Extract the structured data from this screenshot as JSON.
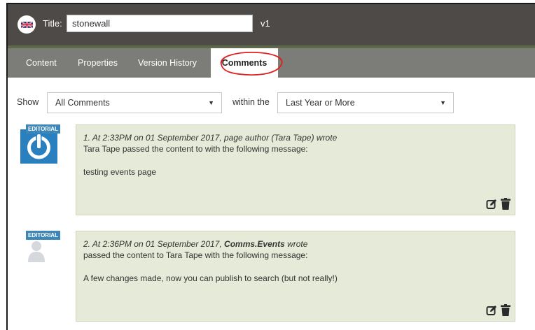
{
  "header": {
    "flag_icon": "uk-flag-icon",
    "title_label": "Title:",
    "title_value": "stonewall",
    "version": "v1"
  },
  "tabs": [
    {
      "label": "Content",
      "active": false
    },
    {
      "label": "Properties",
      "active": false
    },
    {
      "label": "Version History",
      "active": false
    },
    {
      "label": "Comments",
      "active": true
    }
  ],
  "filters": {
    "show_label": "Show",
    "show_value": "All Comments",
    "within_label": "within the",
    "within_value": "Last Year or More"
  },
  "comments": [
    {
      "badge": "EDITORIAL",
      "number": "1.",
      "meta_prefix": "At 2:33PM on 01 September 2017, page author (Tara Tape) wrote",
      "author_bold": "",
      "meta_suffix": "",
      "line": "Tara Tape passed the content to with the following message:",
      "message": "testing events page"
    },
    {
      "badge": "EDITORIAL",
      "number": "2.",
      "meta_prefix": "At 2:36PM on 01 September 2017,",
      "author_bold": "Comms.Events",
      "meta_suffix": "wrote",
      "line": "passed the content to Tara Tape with the following message:",
      "message": "A few changes made, now you can publish to search (but not really!)"
    }
  ],
  "colors": {
    "header_bg": "#4e4a47",
    "tabbar_bg": "#7c7c79",
    "comment_bg": "#e6ead8",
    "badge_bg": "#3d86b8",
    "annotation": "#e02020"
  }
}
